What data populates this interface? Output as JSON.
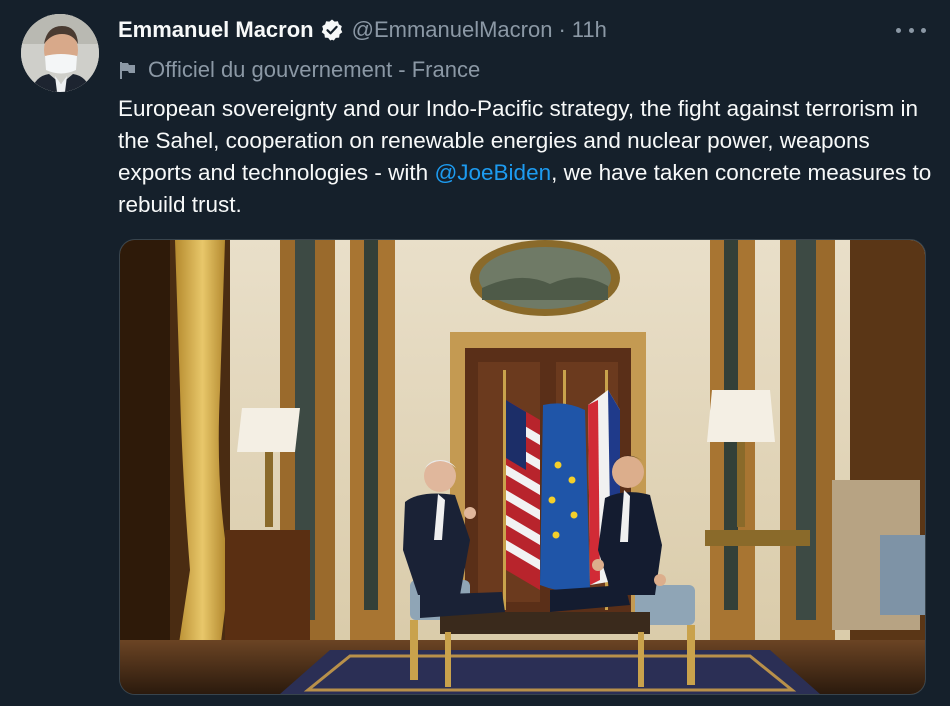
{
  "author": {
    "name": "Emmanuel Macron",
    "handle": "@EmmanuelMacron",
    "separator": "·",
    "time": "11h",
    "verified_icon": "verified-badge-icon"
  },
  "label": {
    "icon": "flag-icon",
    "text": "Officiel du gouvernement - France"
  },
  "tweet": {
    "text_before": "European sovereignty and our Indo-Pacific strategy, the fight against terrorism in the Sahel, cooperation on renewable energies and nuclear power, weapons exports and technologies - with ",
    "mention": "@JoeBiden",
    "text_after": ", we have taken concrete measures to rebuild trust."
  },
  "colors": {
    "background": "#15202b",
    "text": "#f7f9f9",
    "secondary": "#8b98a5",
    "link": "#1d9bf0",
    "border": "#38444d"
  }
}
